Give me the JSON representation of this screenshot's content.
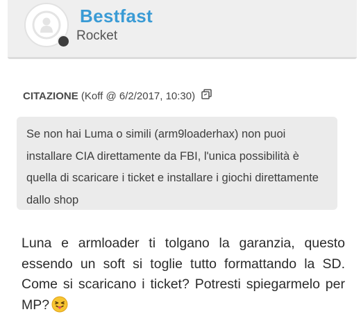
{
  "author": {
    "name": "Bestfast",
    "role": "Rocket",
    "online_status": "offline",
    "status_color": "#3d3d3d",
    "avatar_icon": "default-user-avatar-icon"
  },
  "quote": {
    "label": "CITAZIONE",
    "meta": "(Koff @ 6/2/2017, 10:30)",
    "link_icon": "copy-link-icon",
    "text": "Se non hai Luma o simili (arm9loaderhax) non puoi installare CIA direttamente da FBI, l'unica possibilità è quella di scaricare i ticket e installare i giochi direttamente dallo shop"
  },
  "post": {
    "text": "Luna e armloader ti tolgano la garanzia, questo essendo un soft si toglie tutto formattando la SD. Come si scaricano i ticket? Potresti spiegarmelo per MP?",
    "emoji": "tongue-out-emoji-icon"
  },
  "colors": {
    "accent": "#3a9bd5",
    "card_bg": "#efefef",
    "quote_bg": "#ebebeb"
  }
}
